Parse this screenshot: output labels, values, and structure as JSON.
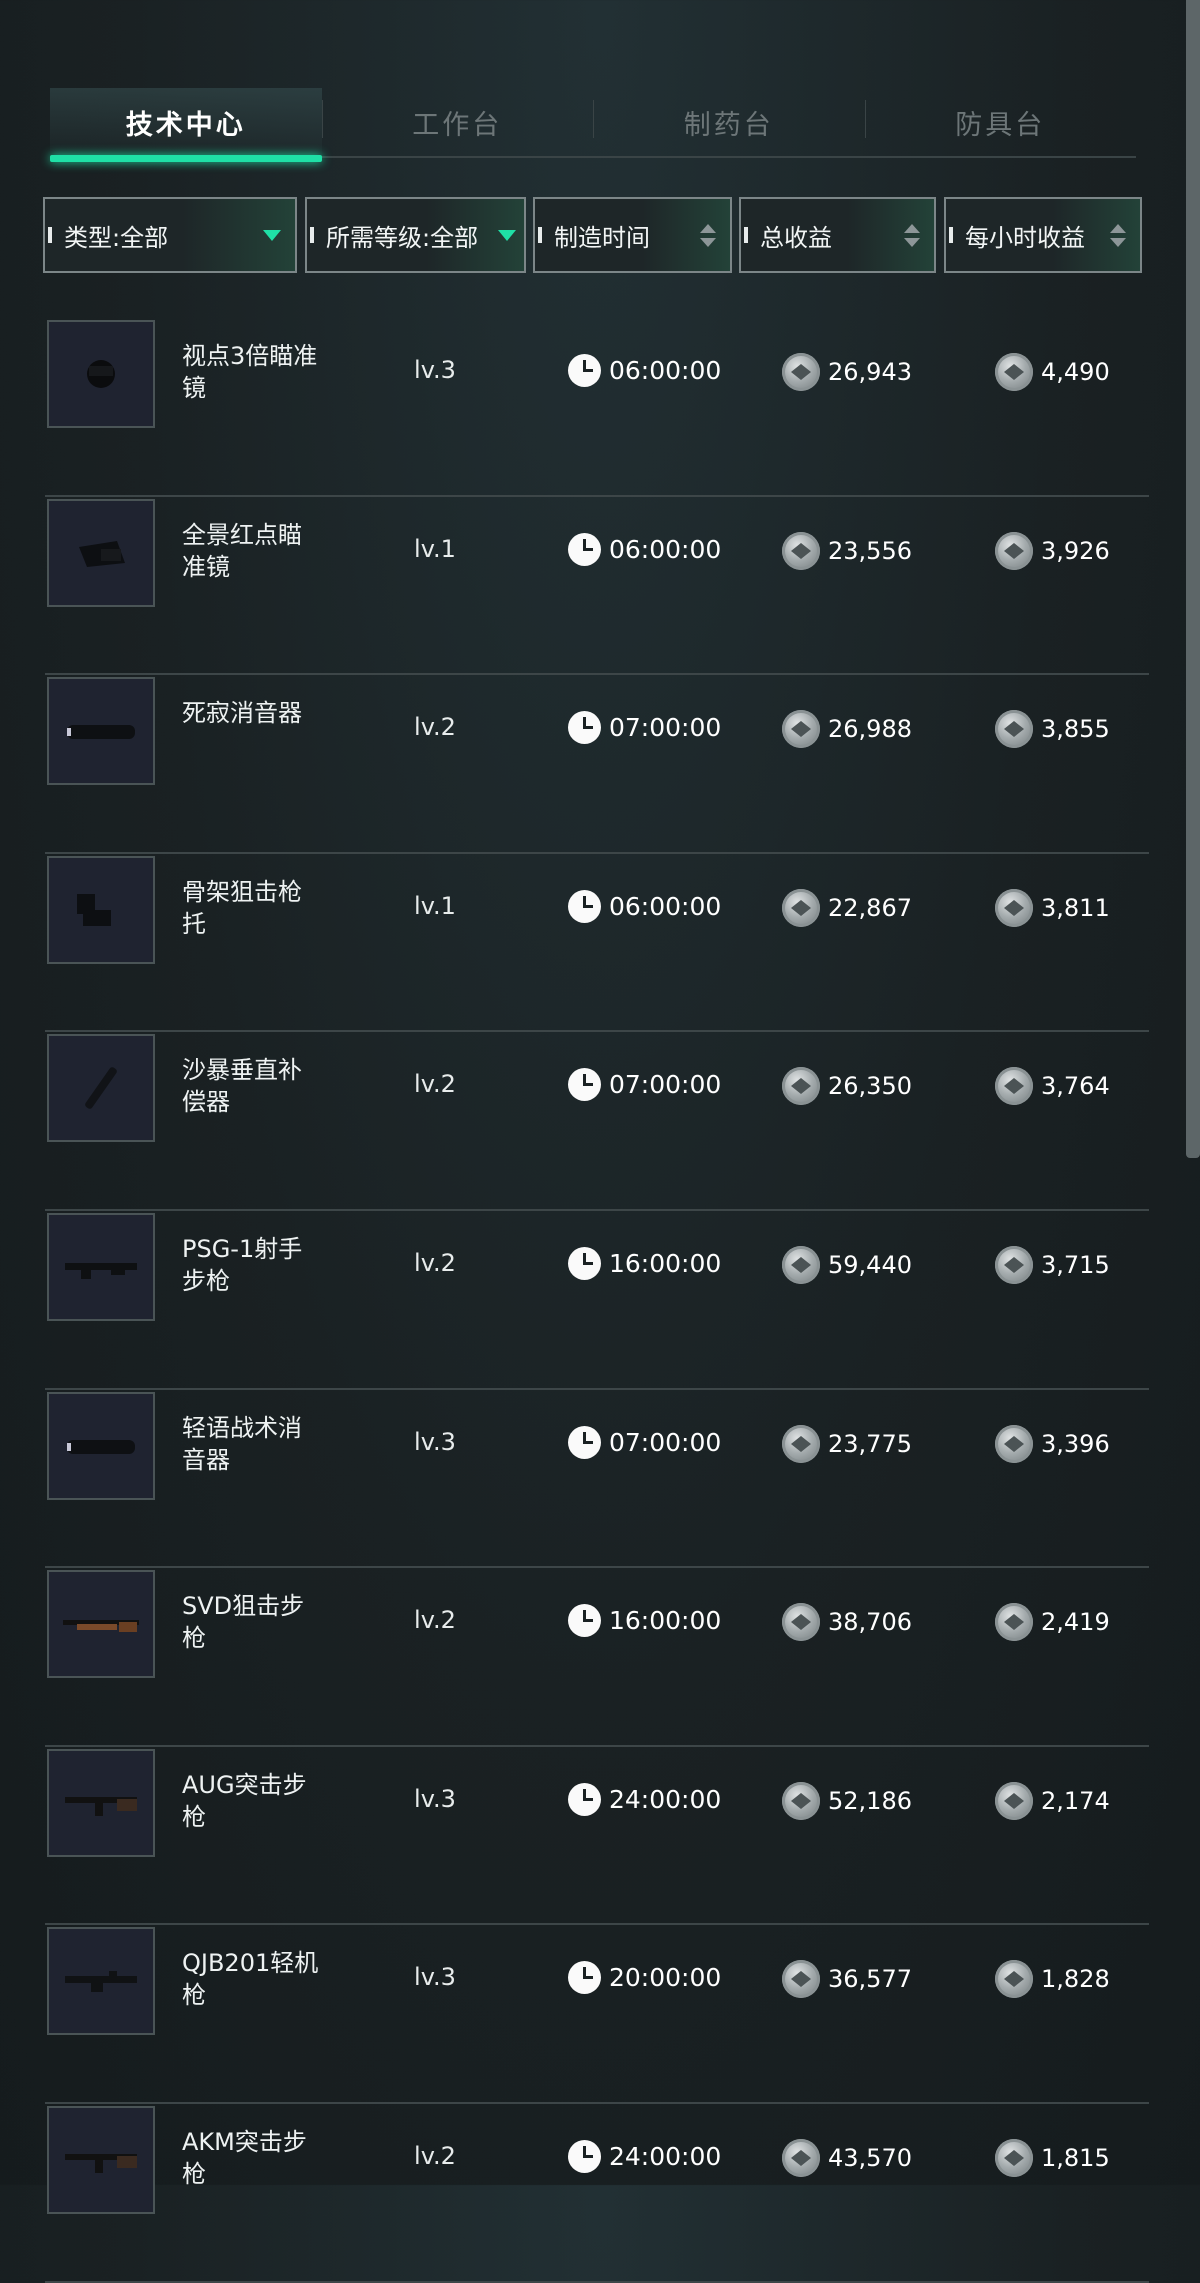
{
  "tabs": [
    {
      "label": "技术中心",
      "active": true
    },
    {
      "label": "工作台",
      "active": false
    },
    {
      "label": "制药台",
      "active": false
    },
    {
      "label": "防具台",
      "active": false
    }
  ],
  "filters": {
    "type": "类型:全部",
    "level": "所需等级:全部",
    "time": "制造时间",
    "total": "总收益",
    "hourly": "每小时收益"
  },
  "colors": {
    "accent": "#1fe0a6",
    "background": "#1a2123",
    "thumb_bg": "#1f2330"
  },
  "items": [
    {
      "name": "视点3倍瞄准镜",
      "level": "lv.3",
      "time": "06:00:00",
      "total": "26,943",
      "hourly": "4,490",
      "icon": "scope-icon"
    },
    {
      "name": "全景红点瞄准镜",
      "level": "lv.1",
      "time": "06:00:00",
      "total": "23,556",
      "hourly": "3,926",
      "icon": "red-dot-sight-icon"
    },
    {
      "name": "死寂消音器",
      "level": "lv.2",
      "time": "07:00:00",
      "total": "26,988",
      "hourly": "3,855",
      "icon": "suppressor-icon"
    },
    {
      "name": "骨架狙击枪托",
      "level": "lv.1",
      "time": "06:00:00",
      "total": "22,867",
      "hourly": "3,811",
      "icon": "stock-icon"
    },
    {
      "name": "沙暴垂直补偿器",
      "level": "lv.2",
      "time": "07:00:00",
      "total": "26,350",
      "hourly": "3,764",
      "icon": "compensator-icon"
    },
    {
      "name": "PSG-1射手步枪",
      "level": "lv.2",
      "time": "16:00:00",
      "total": "59,440",
      "hourly": "3,715",
      "icon": "rifle-icon"
    },
    {
      "name": "轻语战术消音器",
      "level": "lv.3",
      "time": "07:00:00",
      "total": "23,775",
      "hourly": "3,396",
      "icon": "suppressor-icon"
    },
    {
      "name": "SVD狙击步枪",
      "level": "lv.2",
      "time": "16:00:00",
      "total": "38,706",
      "hourly": "2,419",
      "icon": "sniper-rifle-icon"
    },
    {
      "name": "AUG突击步枪",
      "level": "lv.3",
      "time": "24:00:00",
      "total": "52,186",
      "hourly": "2,174",
      "icon": "assault-rifle-icon"
    },
    {
      "name": "QJB201轻机枪",
      "level": "lv.3",
      "time": "20:00:00",
      "total": "36,577",
      "hourly": "1,828",
      "icon": "machine-gun-icon"
    },
    {
      "name": "AKM突击步枪",
      "level": "lv.2",
      "time": "24:00:00",
      "total": "43,570",
      "hourly": "1,815",
      "icon": "assault-rifle-icon"
    }
  ]
}
